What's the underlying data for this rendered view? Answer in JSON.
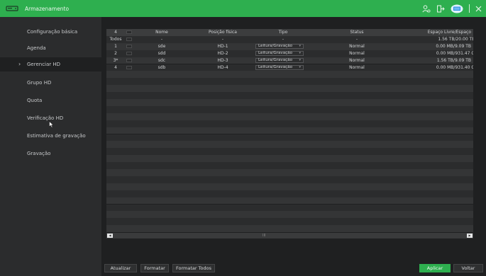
{
  "window": {
    "title": "Armazenamento",
    "icons": [
      "hdd-icon",
      "user-icon",
      "logout-icon",
      "monitor-icon",
      "close-icon"
    ]
  },
  "sidebar": {
    "items": [
      {
        "label": "Configuração básica"
      },
      {
        "label": "Agenda"
      },
      {
        "label": "Gerenciar HD",
        "active": true
      },
      {
        "label": "Grupo HD"
      },
      {
        "label": "Quota"
      },
      {
        "label": "Verificação HD"
      },
      {
        "label": "Estimativa de gravação"
      },
      {
        "label": "Gravação"
      }
    ]
  },
  "table": {
    "header": {
      "num": "4",
      "nome": "Nome",
      "pos": "Posição física",
      "tipo": "Tipo",
      "status": "Status",
      "espaco": "Espaço Livre/Espaço"
    },
    "todos": {
      "num": "Todos",
      "nome": "-",
      "pos": "-",
      "tipo": "-",
      "status": "-",
      "espaco": "1.56 TB/20.00 TE"
    },
    "rows": [
      {
        "num": "1",
        "nome": "sde",
        "pos": "HD-1",
        "tipo": "Leitura/Gravação",
        "status": "Normal",
        "espaco": "0.00 MB/9.09 TB"
      },
      {
        "num": "2",
        "nome": "sdd",
        "pos": "HD-2",
        "tipo": "Leitura/Gravação",
        "status": "Normal",
        "espaco": "0.00 MB/931.47 G"
      },
      {
        "num": "3*",
        "nome": "sdc",
        "pos": "HD-3",
        "tipo": "Leitura/Gravação",
        "status": "Normal",
        "espaco": "1.56 TB/9.09 TB"
      },
      {
        "num": "4",
        "nome": "sdb",
        "pos": "HD-4",
        "tipo": "Leitura/Gravação",
        "status": "Normal",
        "espaco": "0.00 MB/931.40 G"
      }
    ]
  },
  "scrollbar": {
    "thumb": "III"
  },
  "buttons": {
    "atualizar": "Atualizar",
    "formatar": "Formatar",
    "formatar_todos": "Formatar Todos",
    "aplicar": "Aplicar",
    "voltar": "Voltar"
  },
  "colors": {
    "accent": "#2eaf4f",
    "background": "#1f2021",
    "sidebar": "#2b2c2d"
  }
}
